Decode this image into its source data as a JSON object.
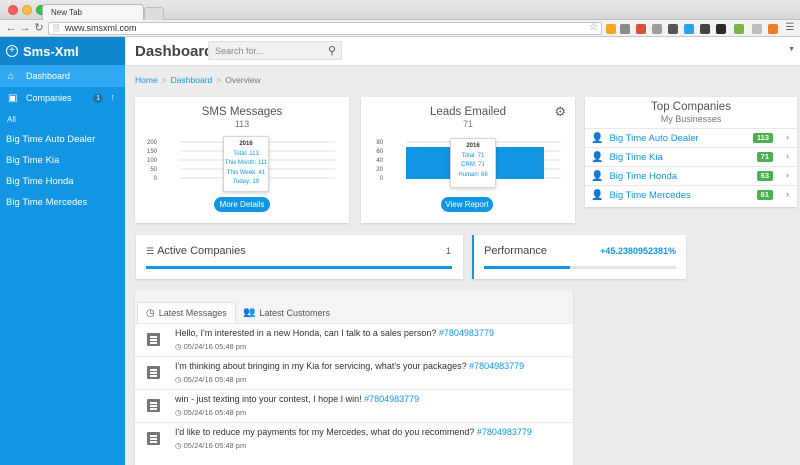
{
  "browser": {
    "tab_title": "New Tab",
    "url": "www.smsxml.com"
  },
  "sidebar": {
    "brand": "Sms-Xml",
    "nav": [
      {
        "label": "Dashboard",
        "icon": "home-icon"
      },
      {
        "label": "Companies",
        "icon": "companies-icon",
        "badge": "1"
      }
    ],
    "filter_label": "All",
    "companies": [
      "Big Time Auto Dealer",
      "Big Time Kia",
      "Big Time Honda",
      "Big Time Mercedes"
    ]
  },
  "header": {
    "title": "Dashboard",
    "search_placeholder": "Search for..."
  },
  "breadcrumb": {
    "items": [
      "Home",
      "Dashboard",
      "Overview"
    ]
  },
  "sms_card": {
    "title": "SMS Messages",
    "count": "113",
    "axis_ticks": [
      "200",
      "150",
      "100",
      "50",
      "0"
    ],
    "tooltip": {
      "year": "2016",
      "total": "Total: 113",
      "month": "This Month: 111",
      "week": "This Week: 41",
      "today": "Today: 19"
    },
    "button": "More Details"
  },
  "leads_card": {
    "title": "Leads Emailed",
    "count": "71",
    "axis_ticks": [
      "80",
      "60",
      "40",
      "20",
      "0"
    ],
    "tooltip": {
      "year": "2016",
      "total": "Total: 71",
      "crm": "CRM: 71",
      "human": "Human: 68"
    },
    "button": "View Report"
  },
  "top_companies": {
    "title": "Top Companies",
    "subtitle": "My Businesses",
    "rows": [
      {
        "name": "Big Time Auto Dealer",
        "count": "113"
      },
      {
        "name": "Big Time Kia",
        "count": "71"
      },
      {
        "name": "Big Time Honda",
        "count": "63"
      },
      {
        "name": "Big Time Mercedes",
        "count": "61"
      }
    ]
  },
  "active_companies": {
    "title": "Active Companies",
    "value": "1",
    "progress": 1.0
  },
  "performance": {
    "title": "Performance",
    "value": "+45.2380952381%",
    "progress": 0.45
  },
  "messages": {
    "tabs": [
      "Latest Messages",
      "Latest Customers"
    ],
    "items": [
      {
        "text": "Hello, I'm interested in a new Honda, can I talk to a sales person?",
        "tag": "#7804983779",
        "time": "05/24/16 05:48 pm"
      },
      {
        "text": "I'm thinking about bringing in my Kia for servicing, what's your packages?",
        "tag": "#7804983779",
        "time": "05/24/16 05:48 pm"
      },
      {
        "text": "win - just texting into your contest, I hope I win!",
        "tag": "#7804983779",
        "time": "05/24/16 05:48 pm"
      },
      {
        "text": "I'd like to reduce my payments for my Mercedes, what do you recommend?",
        "tag": "#7804983779",
        "time": "05/24/16 05:48 pm"
      }
    ]
  },
  "colors": {
    "accent": "#1296e3",
    "badge_green": "#4caf50"
  }
}
